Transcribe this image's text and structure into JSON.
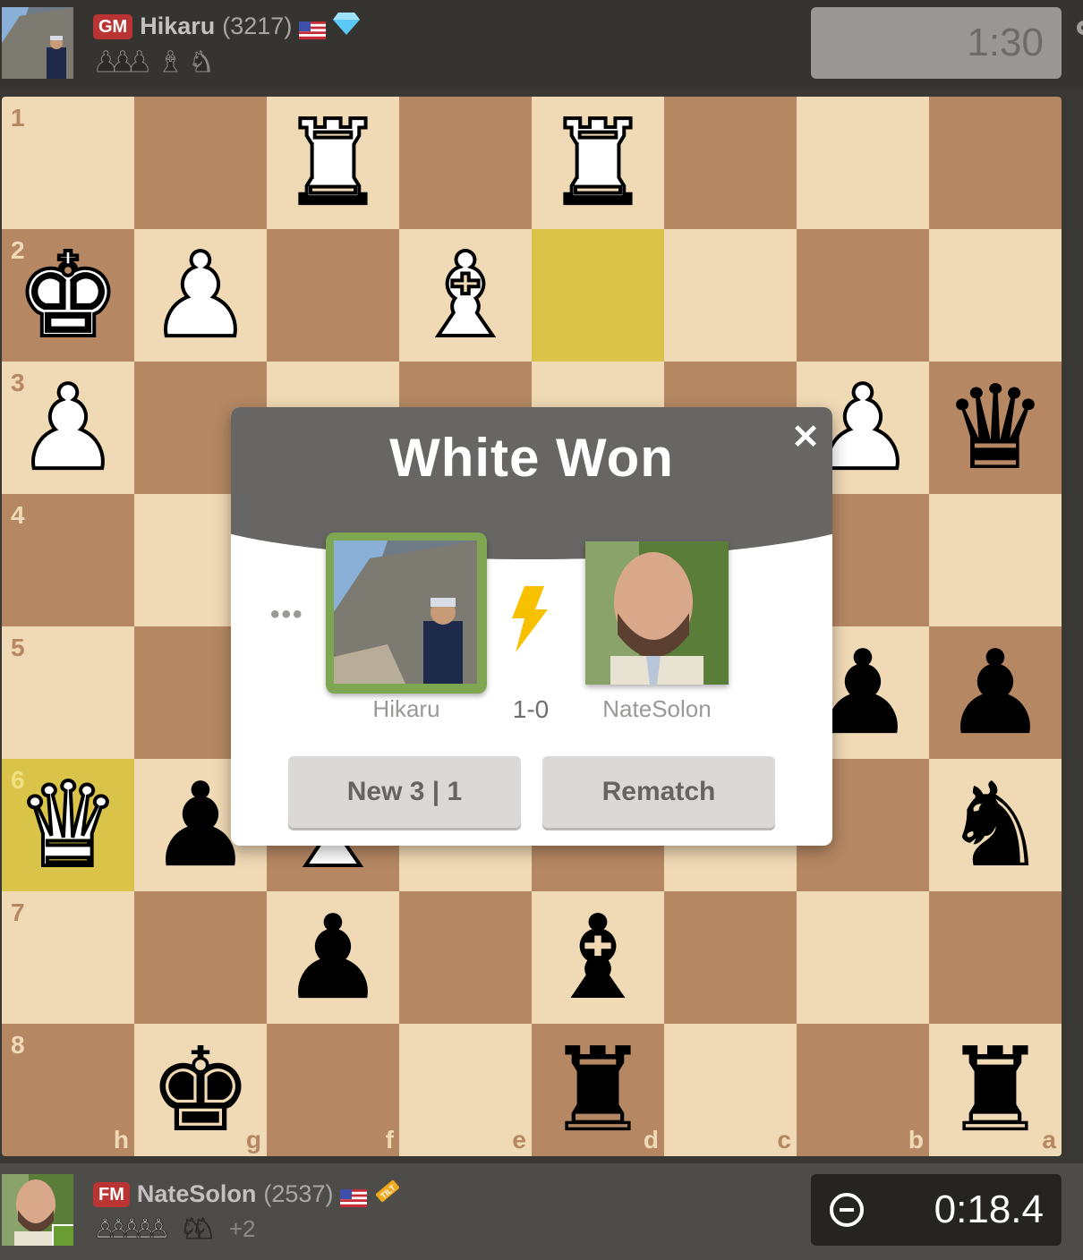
{
  "top_player": {
    "title": "GM",
    "name": "Hikaru",
    "rating": "(3217)",
    "flag": "us-flag-icon",
    "badge": "diamond-icon",
    "captured": [
      "♟♟♟",
      "♝",
      "♞"
    ],
    "clock": "1:30"
  },
  "bottom_player": {
    "title": "FM",
    "name": "NateSolon",
    "rating": "(2537)",
    "flag": "us-flag-icon",
    "badge": "tilt-icon",
    "captured": [
      "♙♙♙♙♙",
      "♘♘"
    ],
    "material_advantage": "+2",
    "clock": "0:18.4",
    "clock_icon": "minus-circle-icon"
  },
  "board": {
    "orientation": "black",
    "files": [
      "h",
      "g",
      "f",
      "e",
      "d",
      "c",
      "b",
      "a"
    ],
    "ranks": [
      "1",
      "2",
      "3",
      "4",
      "5",
      "6",
      "7",
      "8"
    ],
    "colors": {
      "light": "#f0d9b5",
      "dark": "#b58863",
      "highlight": "#d9c348"
    },
    "highlighted": [
      "d2",
      "h6"
    ],
    "pieces": {
      "f1": "wR",
      "d1": "wR",
      "h2": "wK",
      "g2": "wP",
      "e2": "wB",
      "h3": "wP",
      "b3": "wP",
      "a3": "bQ",
      "b5": "bP",
      "a5": "bP",
      "h6": "wQ",
      "g6": "bP",
      "f6": "wB",
      "a6": "bN",
      "f7": "bP",
      "d7": "bB",
      "g8": "bK",
      "d8": "bR",
      "a8": "bR"
    }
  },
  "modal": {
    "title": "White Won",
    "close_icon": "close-icon",
    "more_label": "•••",
    "winner_name": "Hikaru",
    "loser_name": "NateSolon",
    "score": "1-0",
    "game_type_icon": "lightning-bolt-icon",
    "new_game_label": "New 3 | 1",
    "rematch_label": "Rematch",
    "winner_border_color": "#7fa650"
  }
}
